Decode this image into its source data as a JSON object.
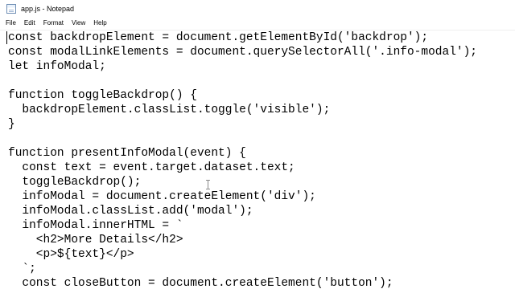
{
  "window": {
    "title": "app.js - Notepad",
    "app_icon": "notepad-icon"
  },
  "menu": {
    "items": [
      "File",
      "Edit",
      "Format",
      "View",
      "Help"
    ]
  },
  "editor": {
    "lines": [
      "const backdropElement = document.getElementById('backdrop');",
      "const modalLinkElements = document.querySelectorAll('.info-modal');",
      "let infoModal;",
      "",
      "function toggleBackdrop() {",
      "  backdropElement.classList.toggle('visible');",
      "}",
      "",
      "function presentInfoModal(event) {",
      "  const text = event.target.dataset.text;",
      "  toggleBackdrop();",
      "  infoModal = document.createElement('div');",
      "  infoModal.classList.add('modal');",
      "  infoModal.innerHTML = `",
      "    <h2>More Details</h2>",
      "    <p>${text}</p>",
      "  `;",
      "  const closeButton = document.createElement('button');"
    ]
  }
}
